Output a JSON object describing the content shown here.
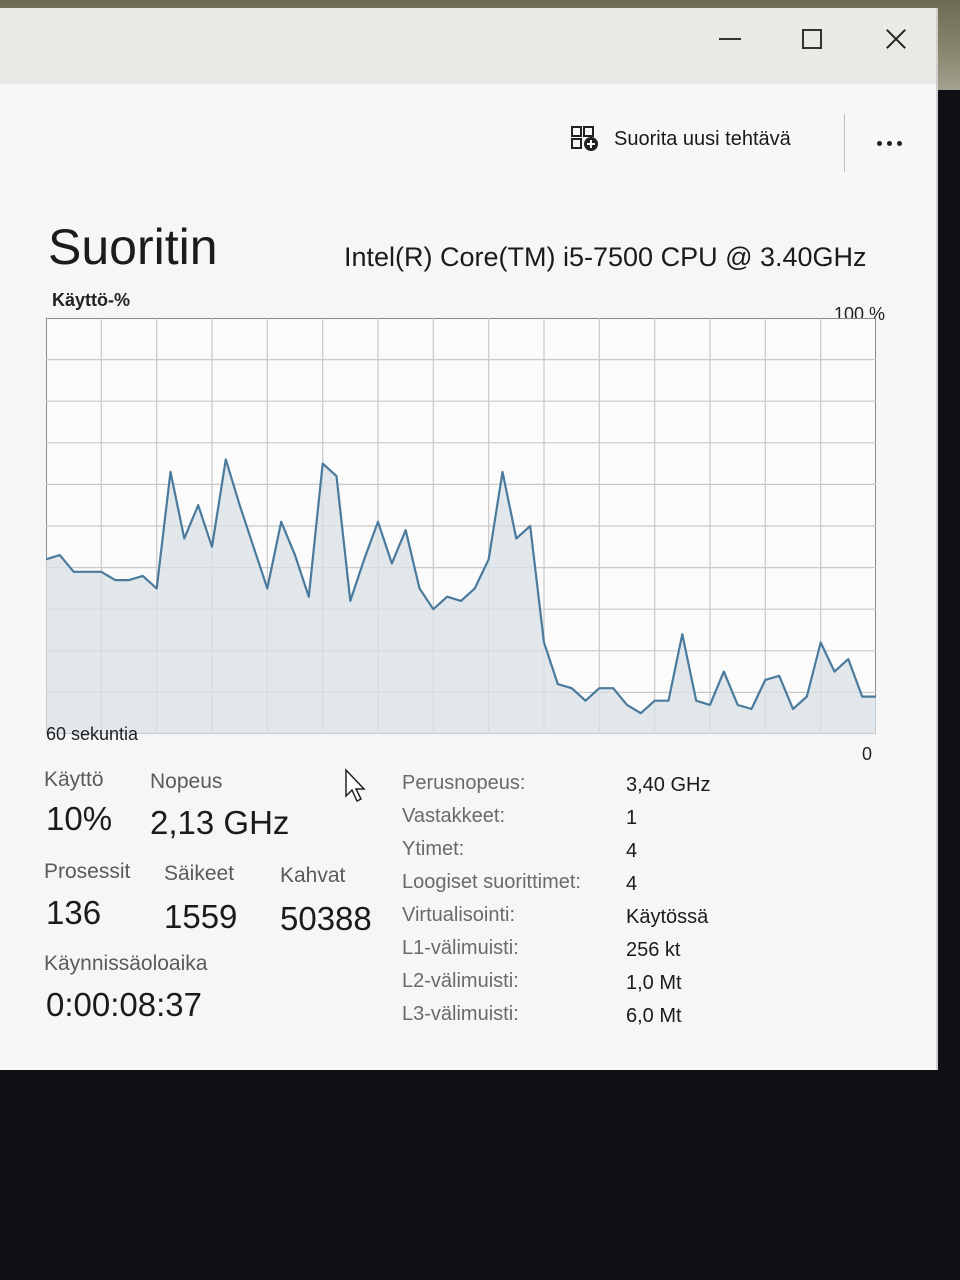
{
  "toolbar": {
    "run_new_task": "Suorita uusi tehtävä",
    "run_icon": "add-task-icon",
    "more_icon": "more-options-icon"
  },
  "header": {
    "title": "Suoritin",
    "cpu_model": "Intel(R) Core(TM) i5-7500 CPU @ 3.40GHz"
  },
  "chart_labels": {
    "y_label": "Käyttö-%",
    "y_max": "100 %",
    "x_label": "60 sekuntia",
    "y_min": "0"
  },
  "chart_data": {
    "type": "area",
    "title": "",
    "ylabel": "Käyttö-%",
    "xlabel": "60 sekuntia",
    "ylim": [
      0,
      100
    ],
    "xlim": [
      0,
      60
    ],
    "grid": true,
    "x": [
      0,
      1,
      2,
      3,
      4,
      5,
      6,
      7,
      8,
      9,
      10,
      11,
      12,
      13,
      14,
      15,
      16,
      17,
      18,
      19,
      20,
      21,
      22,
      23,
      24,
      25,
      26,
      27,
      28,
      29,
      30,
      31,
      32,
      33,
      34,
      35,
      36,
      37,
      38,
      39,
      40,
      41,
      42,
      43,
      44,
      45,
      46,
      47,
      48,
      49,
      50,
      51,
      52,
      53,
      54,
      55,
      56,
      57,
      58,
      59,
      60
    ],
    "values": [
      42,
      43,
      39,
      39,
      39,
      37,
      37,
      38,
      35,
      63,
      47,
      55,
      45,
      66,
      55,
      45,
      35,
      51,
      43,
      33,
      65,
      62,
      32,
      42,
      51,
      41,
      49,
      35,
      30,
      33,
      32,
      35,
      42,
      63,
      47,
      50,
      22,
      12,
      11,
      8,
      11,
      11,
      7,
      5,
      8,
      8,
      24,
      8,
      7,
      15,
      7,
      6,
      13,
      14,
      6,
      9,
      22,
      15,
      18,
      9,
      9
    ],
    "line_color": "#4a7a9c",
    "fill_color": "#d8e0e6"
  },
  "stats": {
    "usage_label": "Käyttö",
    "usage_value": "10%",
    "speed_label": "Nopeus",
    "speed_value": "2,13 GHz",
    "processes_label": "Prosessit",
    "processes_value": "136",
    "threads_label": "Säikeet",
    "threads_value": "1559",
    "handles_label": "Kahvat",
    "handles_value": "50388",
    "uptime_label": "Käynnissäoloaika",
    "uptime_value": "0:00:08:37"
  },
  "info": [
    {
      "key": "Perusnopeus:",
      "value": "3,40 GHz"
    },
    {
      "key": "Vastakkeet:",
      "value": "1"
    },
    {
      "key": "Ytimet:",
      "value": "4"
    },
    {
      "key": "Loogiset suorittimet:",
      "value": "4"
    },
    {
      "key": "Virtualisointi:",
      "value": "Käytössä"
    },
    {
      "key": "L1-välimuisti:",
      "value": "256 kt"
    },
    {
      "key": "L2-välimuisti:",
      "value": "1,0 Mt"
    },
    {
      "key": "L3-välimuisti:",
      "value": "6,0 Mt"
    }
  ]
}
